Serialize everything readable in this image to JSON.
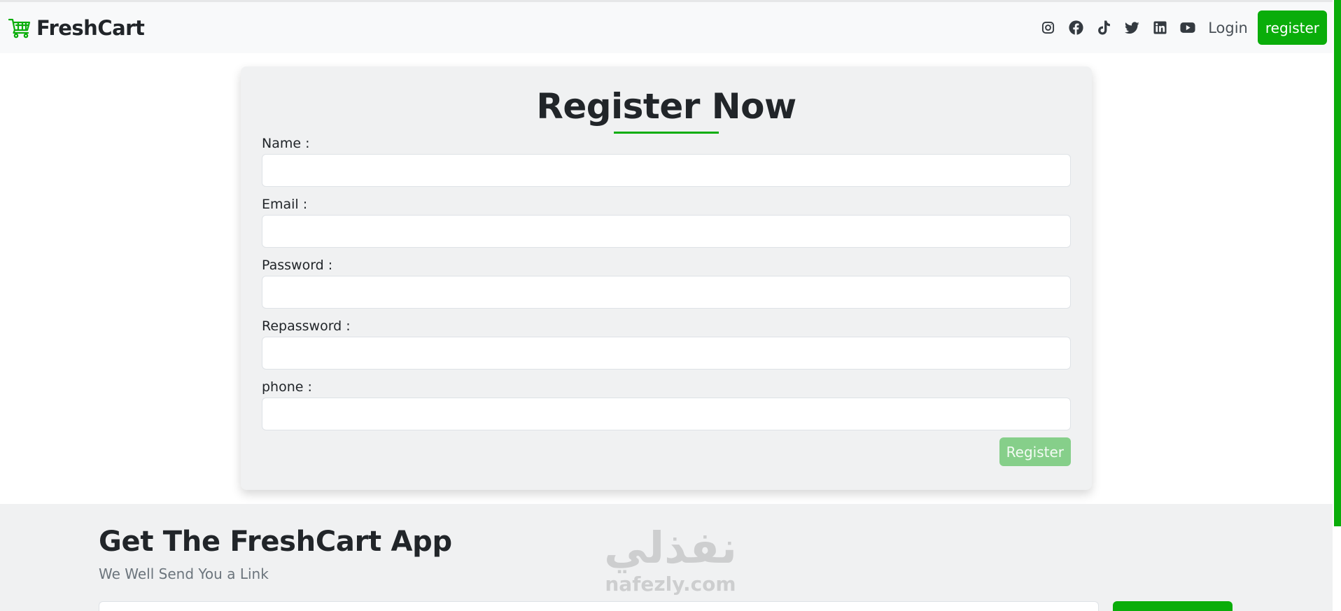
{
  "navbar": {
    "brand_name": "FreshCart",
    "brand_icon": "cart-icon",
    "social_icons": [
      "instagram-icon",
      "facebook-icon",
      "tiktok-icon",
      "twitter-icon",
      "linkedin-icon",
      "youtube-icon"
    ],
    "login_label": "Login",
    "register_label": "register"
  },
  "register_form": {
    "title": "Register Now",
    "fields": [
      {
        "label": "Name :",
        "value": ""
      },
      {
        "label": "Email :",
        "value": ""
      },
      {
        "label": "Password :",
        "value": ""
      },
      {
        "label": "Repassword :",
        "value": ""
      },
      {
        "label": "phone :",
        "value": ""
      }
    ],
    "submit_label": "Register"
  },
  "footer": {
    "title": "Get The FreshCart App",
    "subtitle": "We Well Send You a Link"
  },
  "watermark": {
    "arabic": "نفذلي",
    "latin": "nafezly.com"
  },
  "colors": {
    "accent": "#0aad0a",
    "accent_disabled": "#86cf8a",
    "navbar_bg": "#f8f9fa",
    "card_bg": "#f0f1f2",
    "text": "#212529"
  }
}
